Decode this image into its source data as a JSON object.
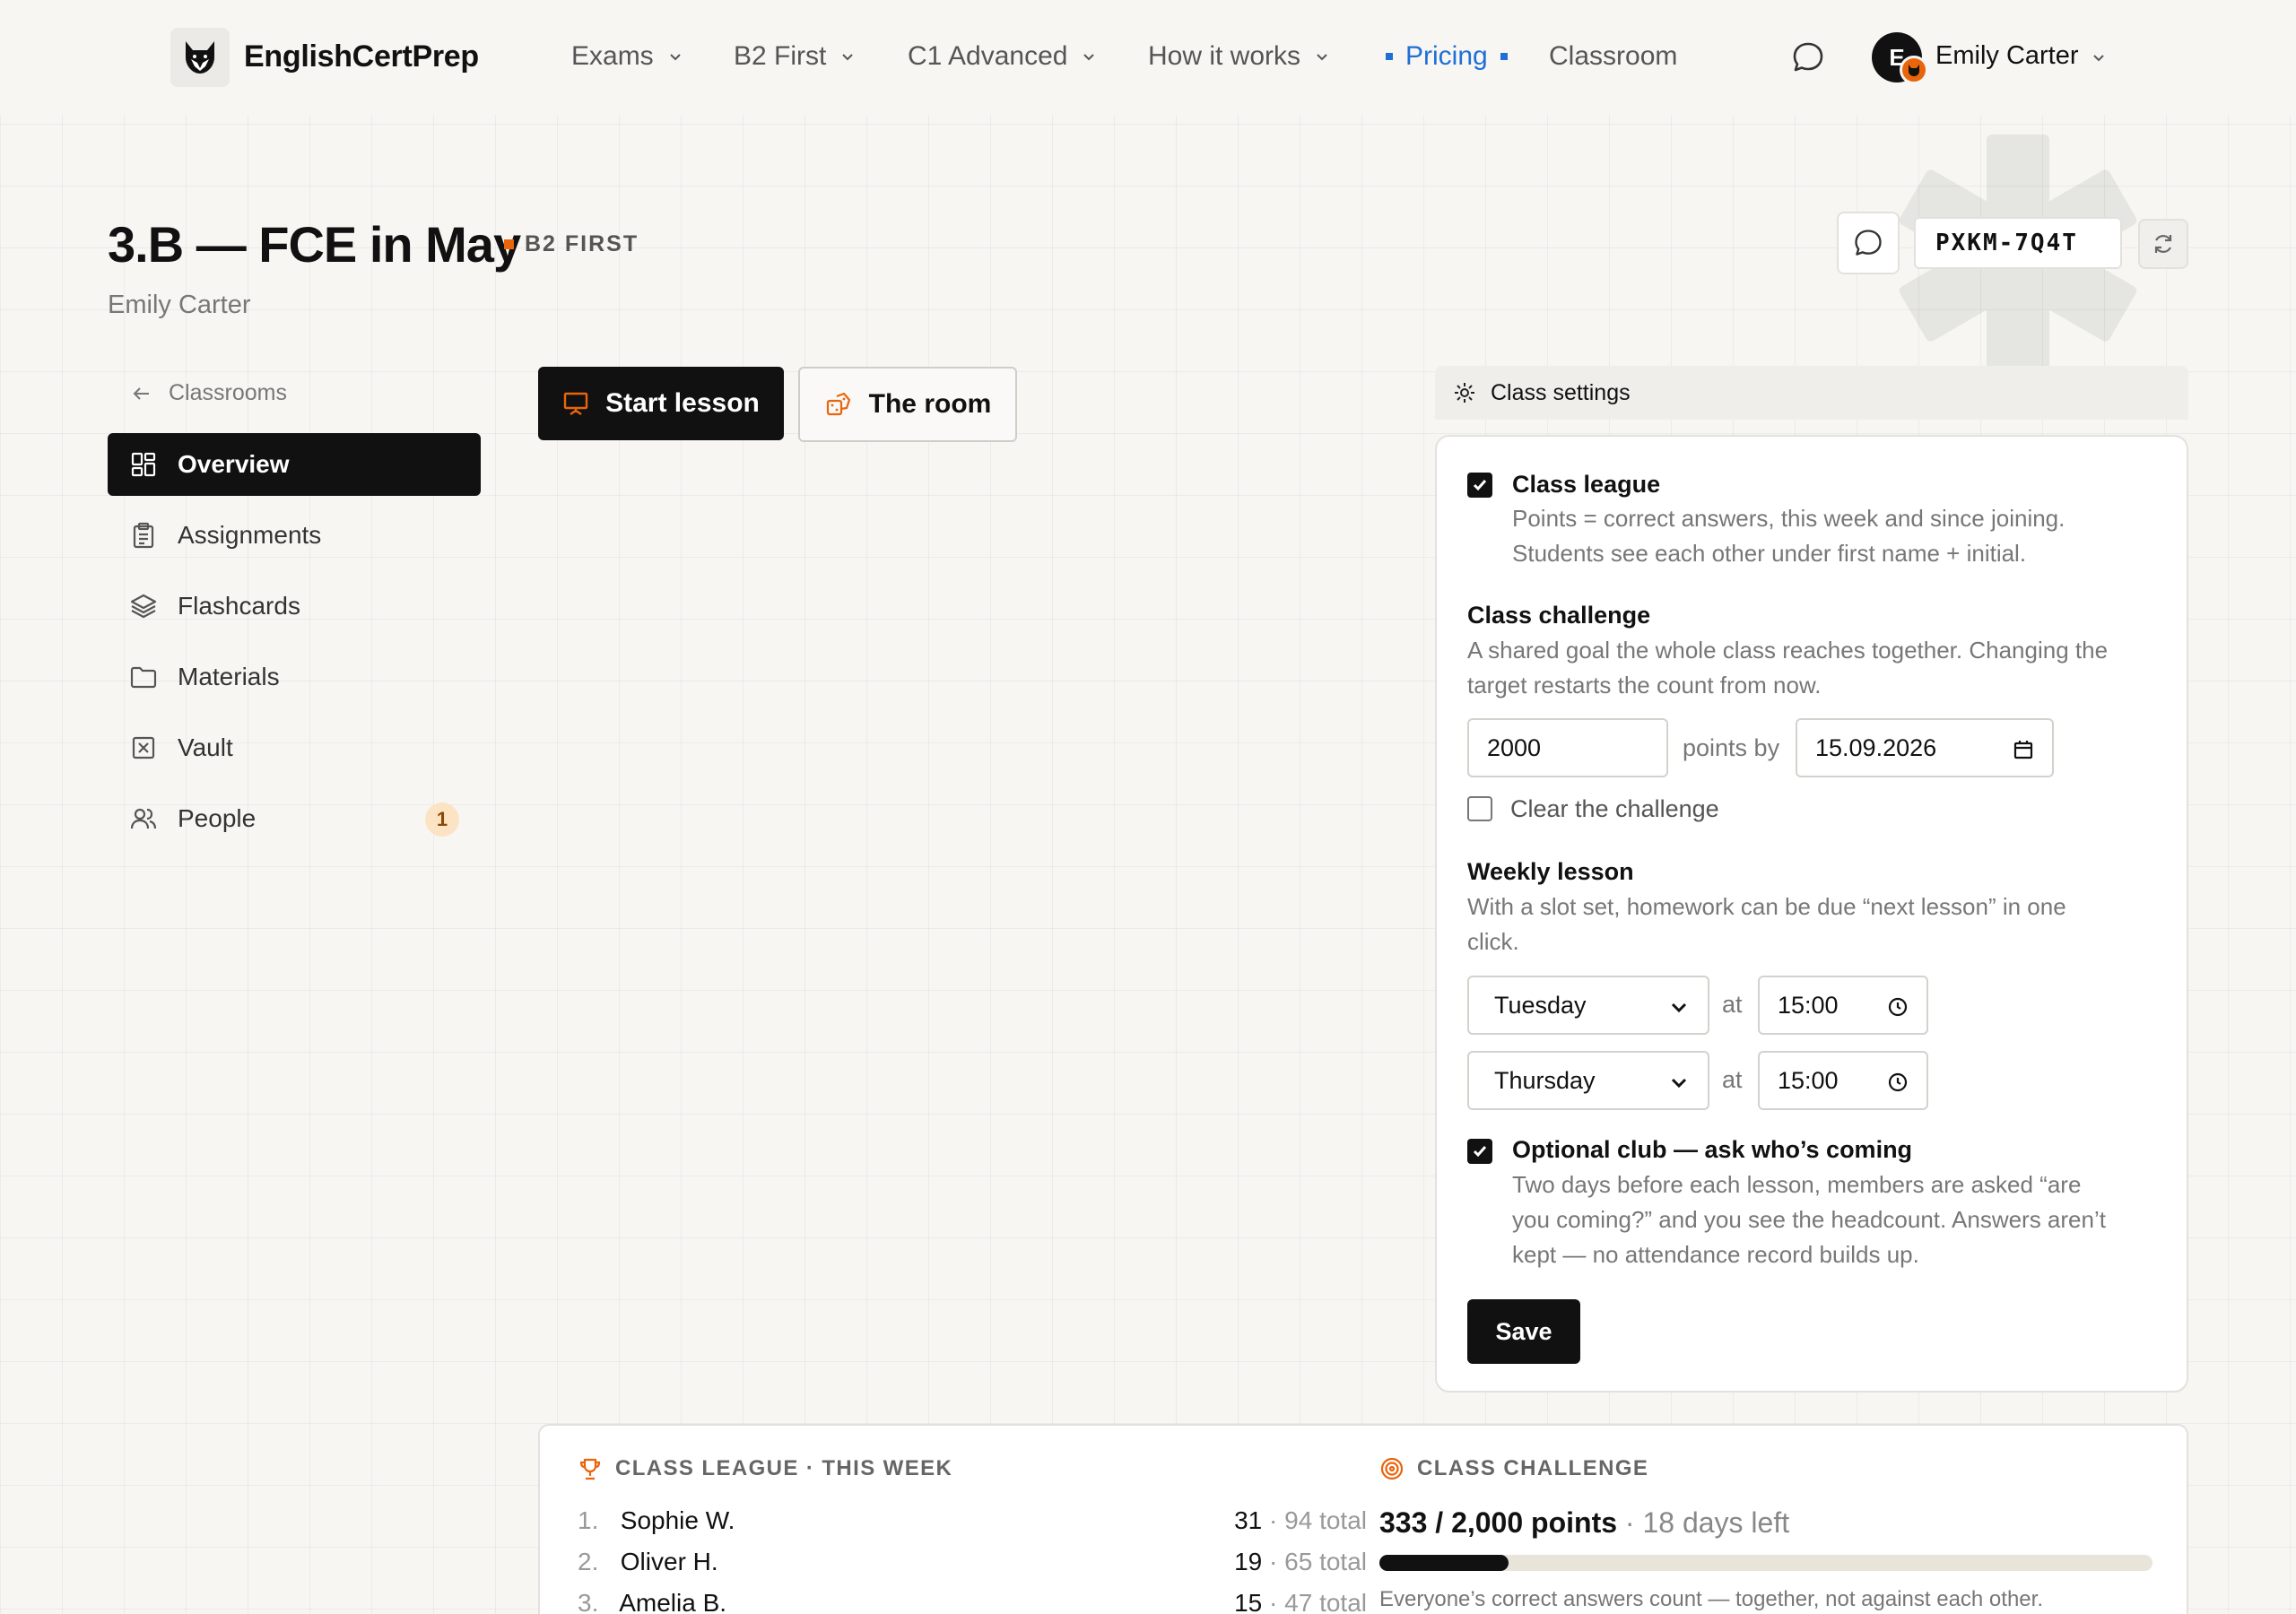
{
  "topbar": {
    "brand": "EnglishCertPrep",
    "nav": [
      {
        "label": "Exams"
      },
      {
        "label": "B2 First"
      },
      {
        "label": "C1 Advanced"
      },
      {
        "label": "How it works"
      },
      {
        "label": "Pricing"
      },
      {
        "label": "Classroom"
      }
    ],
    "user": {
      "initial": "E",
      "name": "Emily Carter"
    }
  },
  "header": {
    "title": "3.B — FCE in May",
    "level": "B2 FIRST",
    "teacher": "Emily Carter",
    "join_code": "PXKM-7Q4T"
  },
  "sidebar": {
    "back_label": "Classrooms",
    "items": [
      {
        "label": "Overview",
        "icon": "grid-icon",
        "active": true
      },
      {
        "label": "Assignments",
        "icon": "clipboard-icon"
      },
      {
        "label": "Flashcards",
        "icon": "layers-icon"
      },
      {
        "label": "Materials",
        "icon": "folder-icon"
      },
      {
        "label": "Vault",
        "icon": "vault-icon"
      },
      {
        "label": "People",
        "icon": "people-icon",
        "badge": "1"
      }
    ]
  },
  "actions": {
    "start_lesson": "Start lesson",
    "the_room": "The room"
  },
  "settings": {
    "header": "Class settings",
    "league": {
      "checked": true,
      "title": "Class league",
      "desc_line1": "Points = correct answers, this week and since joining.",
      "desc_line2": "Students see each other under first name + initial."
    },
    "challenge": {
      "title": "Class challenge",
      "desc_line1": "A shared goal the whole class reaches together. Changing the",
      "desc_line2": "target restarts the count from now.",
      "target": "2000",
      "points_by_label": "points by",
      "date": "15.09.2026",
      "clear_label": "Clear the challenge",
      "clear_checked": false
    },
    "weekly": {
      "title": "Weekly lesson",
      "desc_line1": "With a slot set, homework can be due “next lesson” in one",
      "desc_line2": "click.",
      "at_label": "at",
      "slots": [
        {
          "day": "Tuesday",
          "time": "15:00"
        },
        {
          "day": "Thursday",
          "time": "15:00"
        }
      ]
    },
    "club": {
      "checked": true,
      "title": "Optional club — ask who’s coming",
      "desc_line1": "Two days before each lesson, members are asked “are",
      "desc_line2": "you coming?” and you see the headcount. Answers aren’t",
      "desc_line3": "kept — no attendance record builds up."
    },
    "save_label": "Save"
  },
  "league_card": {
    "label": "CLASS LEAGUE · THIS WEEK",
    "rows": [
      {
        "rank": "1.",
        "name": "Sophie W.",
        "points": "31",
        "total": "· 94 total"
      },
      {
        "rank": "2.",
        "name": "Oliver H.",
        "points": "19",
        "total": "· 65 total"
      },
      {
        "rank": "3.",
        "name": "Amelia B.",
        "points": "15",
        "total": "· 47 total"
      }
    ]
  },
  "challenge_card": {
    "label": "CLASS CHALLENGE",
    "progress_text": "333 / 2,000 points",
    "days_left": "· 18 days left",
    "progress_fraction": 0.1665,
    "note": "Everyone’s correct answers count — together, not against each other."
  },
  "colors": {
    "accent": "#e8650c",
    "link": "#1f6fd6",
    "dark": "#111111"
  }
}
